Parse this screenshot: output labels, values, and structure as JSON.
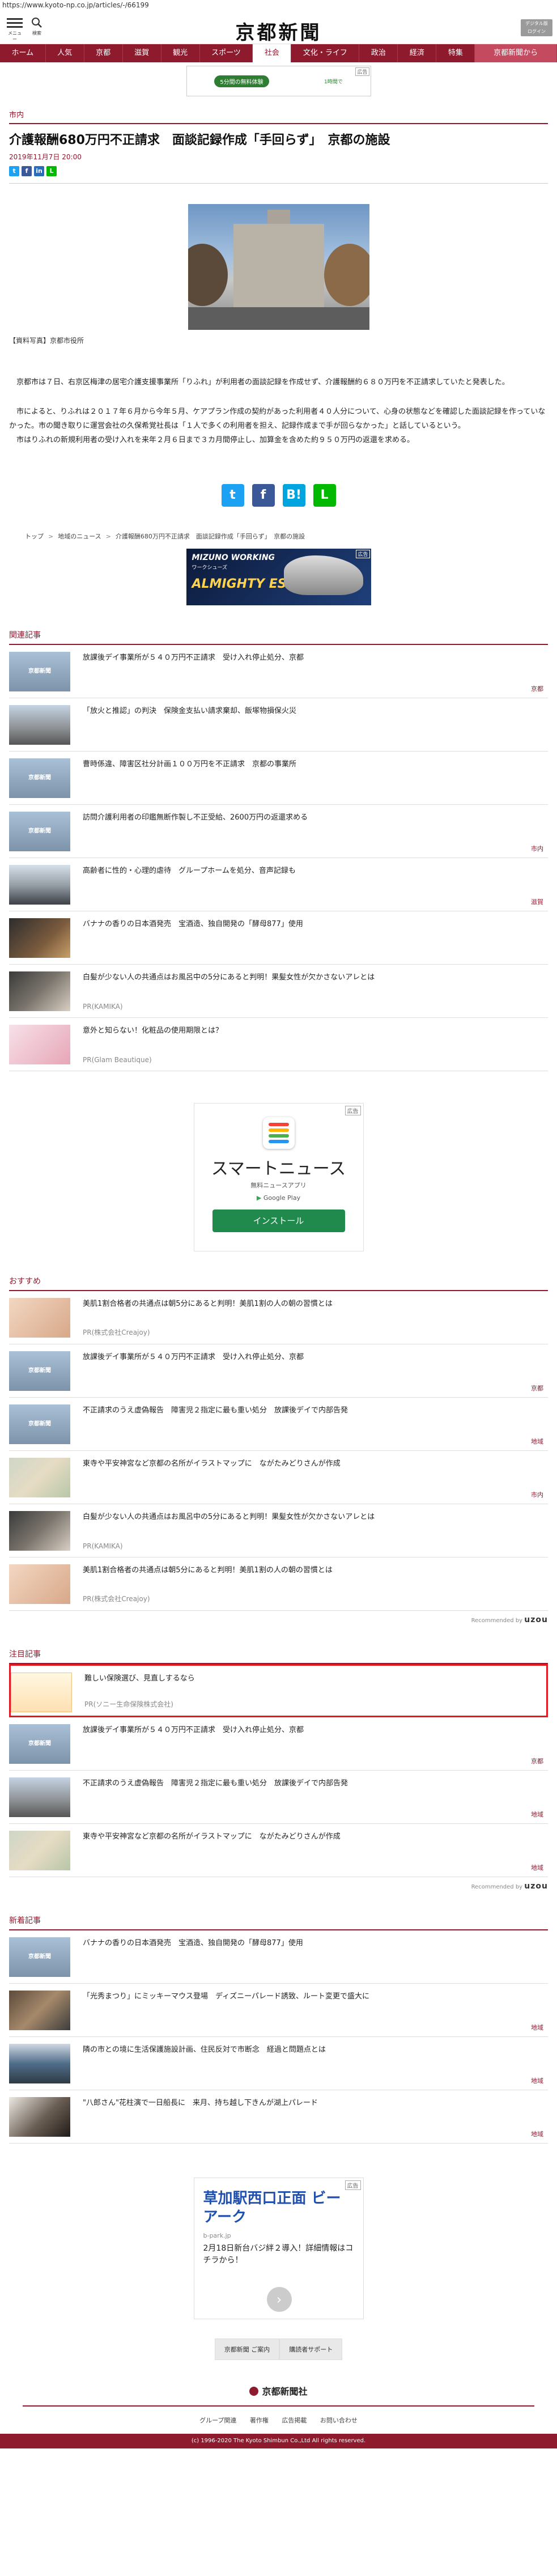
{
  "url": "https://www.kyoto-np.co.jp/articles/-/66199",
  "header": {
    "menu_label": "メニュー",
    "search_label": "検索",
    "logo": "京都新聞",
    "digital_label_1": "デジタル版",
    "digital_label_2": "ログイン"
  },
  "nav": [
    "ホーム",
    "人気",
    "京都",
    "滋賀",
    "観光",
    "スポーツ",
    "社会",
    "文化・ライフ",
    "政治",
    "経済",
    "特集",
    "京都新聞から"
  ],
  "top_ad": {
    "pill": "5分間の無料体験",
    "mini": "1時間で",
    "tag": "広告"
  },
  "article": {
    "category": "市内",
    "title": "介護報酬680万円不正請求　面談記録作成「手回らず」　京都の施設",
    "date": "2019年11月7日 20:00",
    "caption": "【資料写真】京都市役所",
    "paragraphs": [
      "京都市は７日、右京区梅津の居宅介護支援事業所「りふれ」が利用者の面談記録を作成せず、介護報酬約６８０万円を不正請求していたと発表した。",
      "市によると、りふれは２０１７年６月から今年５月、ケアプラン作成の契約があった利用者４０人分について、心身の状態などを確認した面談記録を作っていなかった。市の聞き取りに運営会社の久保希覚社長は「１人で多くの利用者を担え、記録作成まで手が回らなかった」と話しているという。",
      "市はりふれの新規利用者の受け入れを来年２月６日まで３カ月間停止し、加算金を含めた約９５０万円の返還を求める。"
    ],
    "breadcrumb": [
      "トップ",
      "地域のニュース",
      "介護報酬680万円不正請求　面談記録作成「手回らず」　京都の施設"
    ]
  },
  "mid_ad": {
    "brand": "MIZUNO WORKING",
    "sub": "ワークシューズ",
    "prod": "ALMIGHTY ES31L",
    "tag": "広告"
  },
  "related": {
    "heading": "関連記事",
    "items": [
      {
        "title": "放課後デイ事業所が５４０万円不正請求　受け入れ停止処分、京都",
        "tag": "京都",
        "thumb": "kyoto",
        "wm": "京都新聞"
      },
      {
        "title": "「放火と推認」の判決　保険金支払い請求棄却、飯塚物損保火災",
        "tag": "",
        "thumb": "street"
      },
      {
        "title": "曹時係違、障害区社分計画１００万円を不正請求　京都の事業所",
        "tag": "",
        "thumb": "kyoto",
        "wm": "京都新聞"
      },
      {
        "title": "訪問介護利用者の印鑑無断作製し不正受給、2600万円の返還求める",
        "tag": "市内",
        "thumb": "kyoto",
        "wm": "京都新聞"
      },
      {
        "title": "高齢者に性的・心理的虐待　グループホームを処分、音声記録も",
        "tag": "滋賀",
        "thumb": "city"
      },
      {
        "title": "バナナの香りの日本酒発売　宝酒造、独自開発の「酵母877」使用",
        "tag": "",
        "thumb": "food"
      },
      {
        "title": "白髪が少ない人の共通点はお風呂中の5分にあると判明！果髪女性が欠かさないアレとは",
        "pr": "PR(KAMIKA)",
        "thumb": "hair"
      },
      {
        "title": "意外と知らない！化粧品の使用期限とは？",
        "pr": "PR(Glam Beautique)",
        "thumb": "pink"
      }
    ]
  },
  "app_ad": {
    "name": "スマートニュース",
    "desc": "無料ニュースアプリ",
    "store": "Google Play",
    "install": "インストール",
    "tag": "広告"
  },
  "recommend": {
    "heading": "おすすめ",
    "items": [
      {
        "title": "美肌1割合格者の共通点は朝5分にあると判明！美肌1割の人の朝の習慣とは",
        "pr": "PR(株式会社Creajoy)",
        "thumb": "face"
      },
      {
        "title": "放課後デイ事業所が５４０万円不正請求　受け入れ停止処分、京都",
        "tag": "京都",
        "thumb": "kyoto",
        "wm": "京都新聞"
      },
      {
        "title": "不正請求のうえ虚偽報告　障害児２指定に最も重い処分　放課後デイで内部告発",
        "tag": "地域",
        "thumb": "kyoto",
        "wm": "京都新聞"
      },
      {
        "title": "東寺や平安神宮など京都の名所がイラストマップに　ながたみどりさんが作成",
        "tag": "市内",
        "thumb": "map"
      },
      {
        "title": "白髪が少ない人の共通点はお風呂中の5分にあると判明！果髪女性が欠かさないアレとは",
        "pr": "PR(KAMIKA)",
        "thumb": "hair"
      },
      {
        "title": "美肌1割合格者の共通点は朝5分にあると判明！美肌1割の人の朝の習慣とは",
        "pr": "PR(株式会社Creajoy)",
        "thumb": "face"
      }
    ],
    "powered": "Recommended by",
    "powered_brand": "uzou"
  },
  "featured": {
    "heading": "注目記事",
    "items": [
      {
        "title": "難しい保険選び、見直しするなら",
        "pr": "PR(ソニー生命保険株式会社)",
        "thumb": "insur",
        "highlight": true
      },
      {
        "title": "放課後デイ事業所が５４０万円不正請求　受け入れ停止処分、京都",
        "tag": "京都",
        "thumb": "kyoto",
        "wm": "京都新聞"
      },
      {
        "title": "不正請求のうえ虚偽報告　障害児２指定に最も重い処分　放課後デイで内部告発",
        "tag": "地域",
        "thumb": "street"
      },
      {
        "title": "東寺や平安神宮など京都の名所がイラストマップに　ながたみどりさんが作成",
        "tag": "地域",
        "thumb": "map"
      }
    ],
    "powered": "Recommended by",
    "powered_brand": "uzou"
  },
  "latest": {
    "heading": "新着記事",
    "items": [
      {
        "title": "バナナの香りの日本酒発売　宝酒造、独自開発の「酵母877」使用",
        "tag": "",
        "thumb": "kyoto",
        "wm": "京都新聞"
      },
      {
        "title": "「光秀まつり」にミッキーマウス登場　ディズニーパレード誘致、ルート変更で盛大に",
        "tag": "地域",
        "thumb": "crowd"
      },
      {
        "title": "隣の市との境に生活保護施設計画、住民反対で市断念　経過と問題点とは",
        "tag": "地域",
        "thumb": "train"
      },
      {
        "title": "\"八郎さん\"花柱演で一日船長に　来月、持ち越し下きんが湖上パレード",
        "tag": "地域",
        "thumb": "man"
      }
    ]
  },
  "bottom_ad": {
    "headline": "草加駅西口正面 ビーアーク",
    "domain": "b-park.jp",
    "text": "2月18日新台バジ絆２導入！詳細情報はコチラから！",
    "tag": "広告"
  },
  "footer": {
    "btn1": "京都新聞 ご案内",
    "btn2": "購読者サポート",
    "logo": "京都新聞社",
    "links": [
      "グループ関連",
      "著作権",
      "広告掲載",
      "お問い合わせ"
    ],
    "copyright": "(c) 1996-2020 The Kyoto Shimbun Co.,Ltd All rights reserved."
  }
}
